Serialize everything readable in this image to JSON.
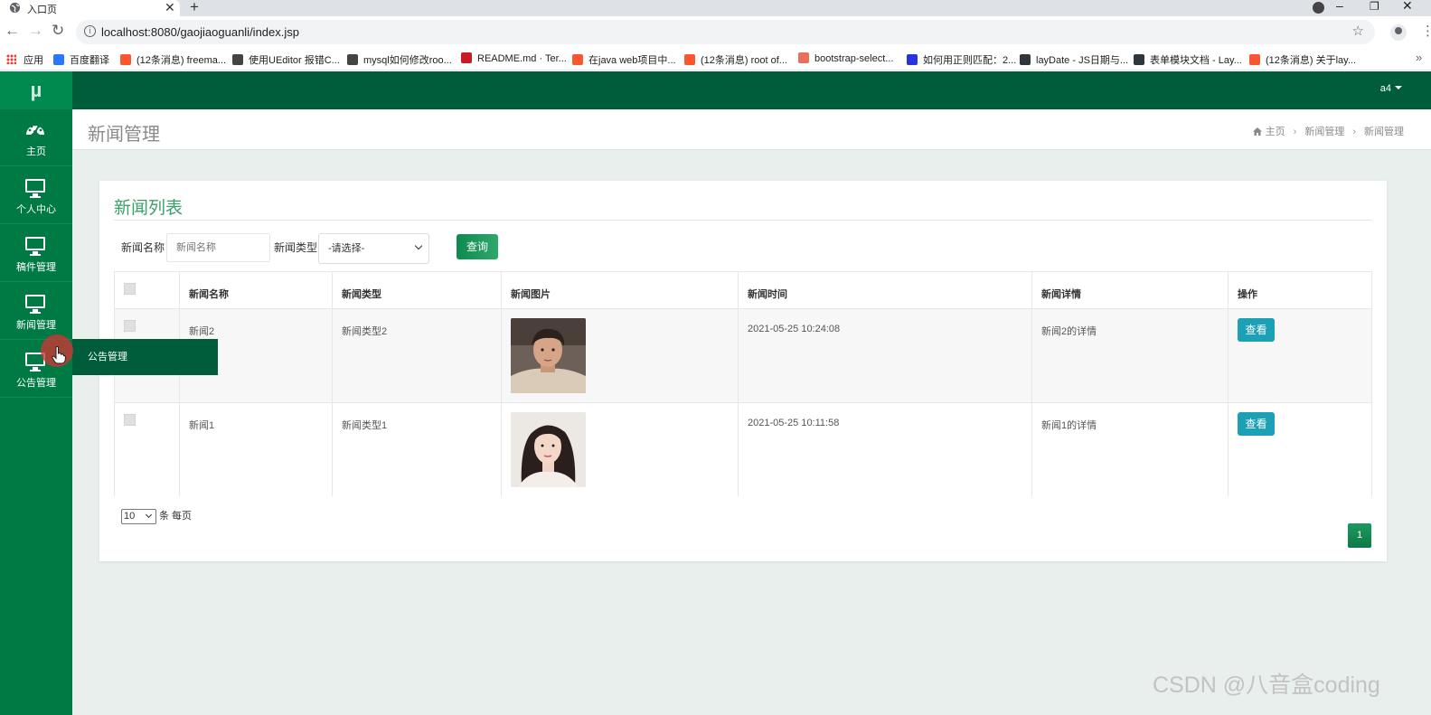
{
  "browser": {
    "tab_title": "入口页",
    "url": "localhost:8080/gaojiaoguanli/index.jsp",
    "bookmarks": [
      {
        "label": "应用",
        "icon": "apps-grid-icon",
        "color": "#ea4335"
      },
      {
        "label": "百度翻译",
        "icon": "baidu-translate-icon",
        "color": "#2878ff"
      },
      {
        "label": "(12条消息) freema...",
        "icon": "csdn-icon",
        "color": "#fc5531"
      },
      {
        "label": "使用UEditor 报错C...",
        "icon": "page-icon",
        "color": "#444444"
      },
      {
        "label": "mysql如何修改roo...",
        "icon": "page-icon",
        "color": "#444444"
      },
      {
        "label": "README.md · Ter...",
        "icon": "gitee-icon",
        "color": "#c71d23"
      },
      {
        "label": "在java web项目中...",
        "icon": "csdn-icon",
        "color": "#fc5531"
      },
      {
        "label": "(12条消息) root of...",
        "icon": "csdn-icon",
        "color": "#fc5531"
      },
      {
        "label": "bootstrap-select...",
        "icon": "jianshu-icon",
        "color": "#ea6f5a"
      },
      {
        "label": "如何用正则匹配：2...",
        "icon": "baidu-paw-icon",
        "color": "#2932e1"
      },
      {
        "label": "layDate - JS日期与...",
        "icon": "layui-icon",
        "color": "#2f363c"
      },
      {
        "label": "表单模块文档 - Lay...",
        "icon": "layui-icon",
        "color": "#2f363c"
      },
      {
        "label": "(12条消息) 关于lay...",
        "icon": "csdn-icon",
        "color": "#fc5531"
      }
    ]
  },
  "app": {
    "brand": "µ",
    "user": "a4",
    "sidebar": [
      {
        "label": "主页",
        "icon": "dashboard-icon"
      },
      {
        "label": "个人中心",
        "icon": "monitor-icon"
      },
      {
        "label": "稿件管理",
        "icon": "monitor-icon"
      },
      {
        "label": "新闻管理",
        "icon": "monitor-icon"
      },
      {
        "label": "公告管理",
        "icon": "monitor-icon"
      }
    ],
    "flyout_item": "公告管理",
    "page_title": "新闻管理",
    "breadcrumb": [
      "主页",
      "新闻管理",
      "新闻管理"
    ],
    "panel_title": "新闻列表",
    "search": {
      "name_label": "新闻名称",
      "name_placeholder": "新闻名称",
      "type_label": "新闻类型",
      "type_selected": "-请选择-",
      "button": "查询"
    },
    "table": {
      "headers": [
        "新闻名称",
        "新闻类型",
        "新闻图片",
        "新闻时间",
        "新闻详情",
        "操作"
      ],
      "rows": [
        {
          "name": "新闻2",
          "type": "新闻类型2",
          "image": "photo-young-man",
          "time": "2021-05-25 10:24:08",
          "detail": "新闻2的详情",
          "action": "查看"
        },
        {
          "name": "新闻1",
          "type": "新闻类型1",
          "image": "photo-young-woman",
          "time": "2021-05-25 10:11:58",
          "detail": "新闻1的详情",
          "action": "查看"
        }
      ]
    },
    "pager": {
      "page_size": "10",
      "page_size_suffix": "条 每页",
      "current_page": "1"
    },
    "colors": {
      "sidebar": "#007a45",
      "topbar": "#005d3b",
      "accent": "#3aa06a",
      "view_button": "#1ca0b6"
    }
  },
  "watermark": "CSDN @八音盒coding"
}
